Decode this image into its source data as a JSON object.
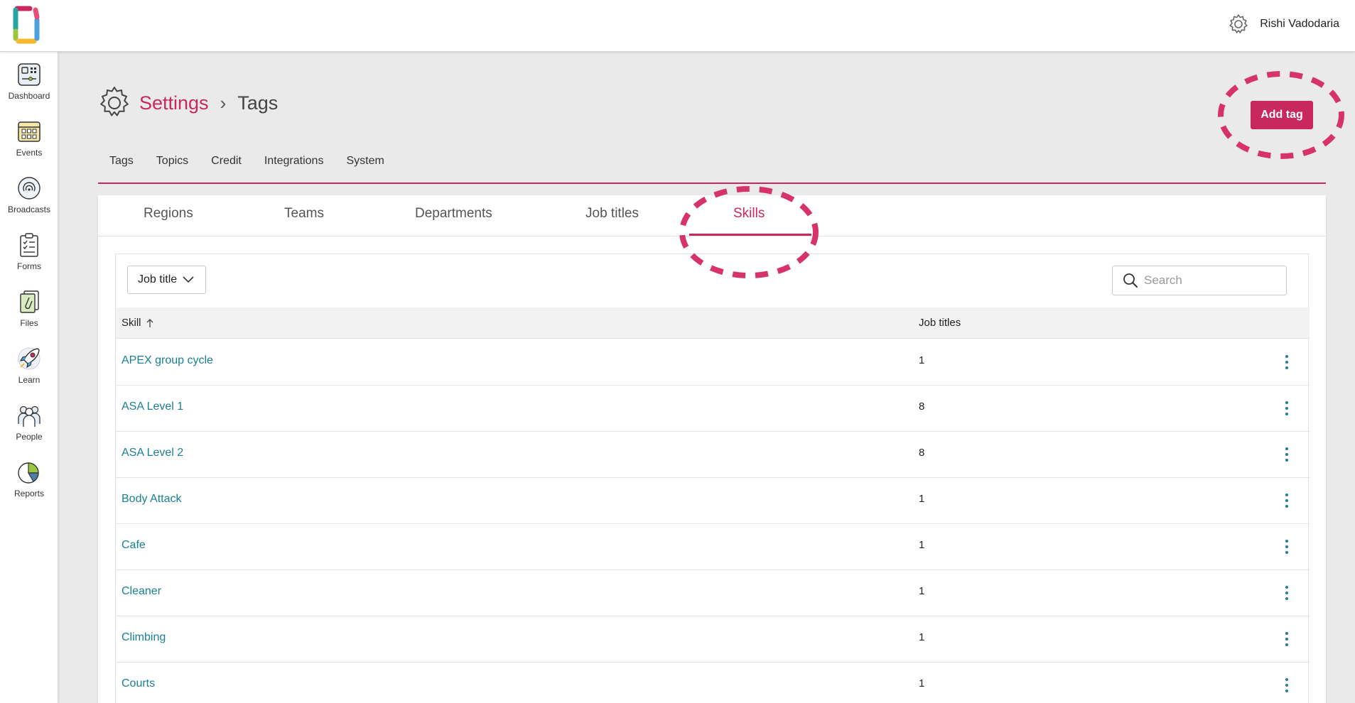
{
  "user": {
    "name": "Rishi Vadodaria"
  },
  "sidebar": {
    "items": [
      {
        "label": "Dashboard",
        "icon": "dashboard-icon"
      },
      {
        "label": "Events",
        "icon": "calendar-icon"
      },
      {
        "label": "Broadcasts",
        "icon": "broadcast-icon"
      },
      {
        "label": "Forms",
        "icon": "clipboard-icon"
      },
      {
        "label": "Files",
        "icon": "files-icon"
      },
      {
        "label": "Learn",
        "icon": "rocket-icon"
      },
      {
        "label": "People",
        "icon": "people-icon"
      },
      {
        "label": "Reports",
        "icon": "pie-chart-icon"
      }
    ]
  },
  "breadcrumb": {
    "root": "Settings",
    "separator": "›",
    "current": "Tags"
  },
  "actions": {
    "add_tag_label": "Add tag"
  },
  "primary_tabs": [
    {
      "label": "Tags"
    },
    {
      "label": "Topics"
    },
    {
      "label": "Credit"
    },
    {
      "label": "Integrations"
    },
    {
      "label": "System"
    }
  ],
  "sub_tabs": [
    {
      "label": "Regions"
    },
    {
      "label": "Teams"
    },
    {
      "label": "Departments"
    },
    {
      "label": "Job titles"
    },
    {
      "label": "Skills",
      "active": true
    }
  ],
  "filter": {
    "dropdown_label": "Job title"
  },
  "search": {
    "placeholder": "Search",
    "value": ""
  },
  "table": {
    "headers": {
      "skill": "Skill",
      "job_titles": "Job titles"
    },
    "sort": {
      "column": "skill",
      "direction": "ascending"
    },
    "rows": [
      {
        "skill": "APEX group cycle",
        "job_titles": "1"
      },
      {
        "skill": "ASA Level 1",
        "job_titles": "8"
      },
      {
        "skill": "ASA Level 2",
        "job_titles": "8"
      },
      {
        "skill": "Body Attack",
        "job_titles": "1"
      },
      {
        "skill": "Cafe",
        "job_titles": "1"
      },
      {
        "skill": "Cleaner",
        "job_titles": "1"
      },
      {
        "skill": "Climbing",
        "job_titles": "1"
      },
      {
        "skill": "Courts",
        "job_titles": "1"
      }
    ]
  },
  "colors": {
    "accent": "#c8285e",
    "link": "#1a7f94",
    "background": "#eaeaea",
    "annotation": "#d6336c"
  }
}
